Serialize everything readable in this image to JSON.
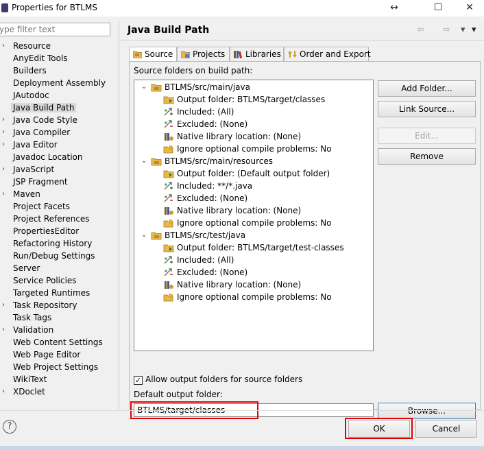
{
  "window": {
    "title": "Properties for BTLMS",
    "controls": [
      "↔",
      "☐",
      "✕"
    ]
  },
  "filter": {
    "placeholder": "ype filter text"
  },
  "sidebar": {
    "items": [
      {
        "label": "Resource",
        "expandable": true
      },
      {
        "label": "AnyEdit Tools",
        "expandable": false
      },
      {
        "label": "Builders",
        "expandable": false
      },
      {
        "label": "Deployment Assembly",
        "expandable": false
      },
      {
        "label": "JAutodoc",
        "expandable": false
      },
      {
        "label": "Java Build Path",
        "expandable": false,
        "selected": true
      },
      {
        "label": "Java Code Style",
        "expandable": true
      },
      {
        "label": "Java Compiler",
        "expandable": true
      },
      {
        "label": "Java Editor",
        "expandable": true
      },
      {
        "label": "Javadoc Location",
        "expandable": false
      },
      {
        "label": "JavaScript",
        "expandable": true
      },
      {
        "label": "JSP Fragment",
        "expandable": false
      },
      {
        "label": "Maven",
        "expandable": true
      },
      {
        "label": "Project Facets",
        "expandable": false
      },
      {
        "label": "Project References",
        "expandable": false
      },
      {
        "label": "PropertiesEditor",
        "expandable": false
      },
      {
        "label": "Refactoring History",
        "expandable": false
      },
      {
        "label": "Run/Debug Settings",
        "expandable": false
      },
      {
        "label": "Server",
        "expandable": false
      },
      {
        "label": "Service Policies",
        "expandable": false
      },
      {
        "label": "Targeted Runtimes",
        "expandable": false
      },
      {
        "label": "Task Repository",
        "expandable": true
      },
      {
        "label": "Task Tags",
        "expandable": false
      },
      {
        "label": "Validation",
        "expandable": true
      },
      {
        "label": "Web Content Settings",
        "expandable": false
      },
      {
        "label": "Web Page Editor",
        "expandable": false
      },
      {
        "label": "Web Project Settings",
        "expandable": false
      },
      {
        "label": "WikiText",
        "expandable": false
      },
      {
        "label": "XDoclet",
        "expandable": true
      }
    ]
  },
  "page": {
    "title": "Java Build Path",
    "nav": {
      "back": "⇦",
      "forward": "⇨",
      "dropdown": "▾"
    }
  },
  "tabs": [
    {
      "label": "Source",
      "icon": "source-folder-icon",
      "active": true
    },
    {
      "label": "Projects",
      "icon": "projects-icon",
      "active": false
    },
    {
      "label": "Libraries",
      "icon": "libraries-icon",
      "active": false
    },
    {
      "label": "Order and Export",
      "icon": "order-export-icon",
      "active": false
    }
  ],
  "source": {
    "label": "Source folders on build path:",
    "folders": [
      {
        "name": "BTLMS/src/main/java",
        "children": [
          {
            "icon": "output-folder-icon",
            "text": "Output folder: BTLMS/target/classes"
          },
          {
            "icon": "included-icon",
            "text": "Included: (All)"
          },
          {
            "icon": "excluded-icon",
            "text": "Excluded: (None)"
          },
          {
            "icon": "native-library-icon",
            "text": "Native library location: (None)"
          },
          {
            "icon": "ignore-problems-icon",
            "text": "Ignore optional compile problems: No"
          }
        ]
      },
      {
        "name": "BTLMS/src/main/resources",
        "children": [
          {
            "icon": "output-folder-icon",
            "text": "Output folder: (Default output folder)"
          },
          {
            "icon": "included-icon",
            "text": "Included: **/*.java"
          },
          {
            "icon": "excluded-icon",
            "text": "Excluded: (None)"
          },
          {
            "icon": "native-library-icon",
            "text": "Native library location: (None)"
          },
          {
            "icon": "ignore-problems-icon",
            "text": "Ignore optional compile problems: No"
          }
        ]
      },
      {
        "name": "BTLMS/src/test/java",
        "children": [
          {
            "icon": "output-folder-icon",
            "text": "Output folder: BTLMS/target/test-classes"
          },
          {
            "icon": "included-icon",
            "text": "Included: (All)"
          },
          {
            "icon": "excluded-icon",
            "text": "Excluded: (None)"
          },
          {
            "icon": "native-library-icon",
            "text": "Native library location: (None)"
          },
          {
            "icon": "ignore-problems-icon",
            "text": "Ignore optional compile problems: No"
          }
        ]
      }
    ],
    "buttons": {
      "add_folder": "Add Folder...",
      "link_source": "Link Source...",
      "edit": "Edit...",
      "remove": "Remove"
    },
    "allow_output_label": "Allow output folders for source folders",
    "allow_output_checked": true,
    "default_output_label": "Default output folder:",
    "default_output_value": "BTLMS/target/classes",
    "browse": "Browse..."
  },
  "footer": {
    "help": "?",
    "ok": "OK",
    "cancel": "Cancel"
  },
  "colors": {
    "highlight": "#e30000",
    "selection": "#d9d9d9",
    "folder": "#e8b84a"
  }
}
